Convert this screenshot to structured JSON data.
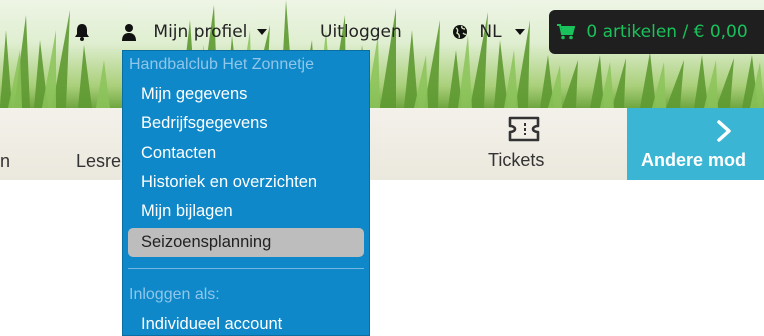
{
  "topbar": {
    "profile_label": "Mijn profiel",
    "logout_label": "Uitloggen",
    "language_label": "NL",
    "cart_label": "0 artikelen / € 0,00"
  },
  "nav": {
    "items": [
      {
        "label": "n"
      },
      {
        "label": "Lesre"
      },
      {
        "label": "Tickets"
      }
    ],
    "other_label": "Andere mod"
  },
  "dropdown": {
    "club_header": "Handbalclub Het Zonnetje",
    "items": [
      {
        "label": "Mijn gegevens"
      },
      {
        "label": "Bedrijfsgegevens"
      },
      {
        "label": "Contacten"
      },
      {
        "label": "Historiek en overzichten"
      },
      {
        "label": "Mijn bijlagen"
      },
      {
        "label": "Seizoensplanning"
      }
    ],
    "login_as_header": "Inloggen als:",
    "login_items": [
      {
        "label": "Individueel account"
      }
    ]
  },
  "colors": {
    "dropdown_bg": "#0e88c8",
    "cart_bg": "#1f1f1f",
    "cart_text": "#19c25a",
    "tile_bg": "#3ab5d4",
    "active_item_bg": "#bdbdbd"
  },
  "icons": [
    "bell-icon",
    "user-icon",
    "caret-down-icon",
    "globe-icon",
    "cart-icon",
    "ticket-icon",
    "chevron-right-icon"
  ]
}
